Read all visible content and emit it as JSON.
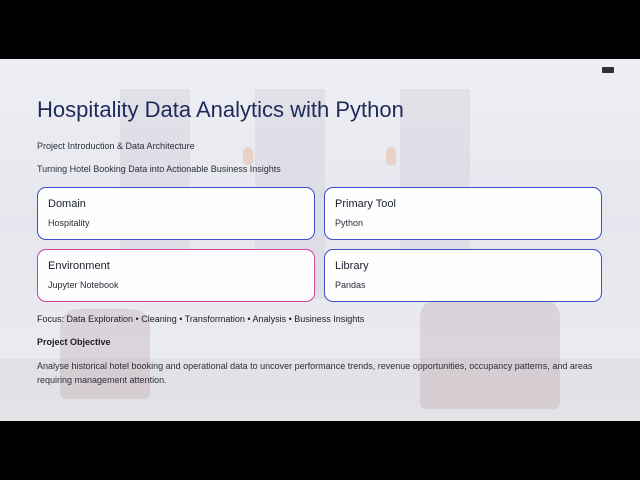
{
  "slide": {
    "title": "Hospitality Data Analytics with Python",
    "subtitle": "Project Introduction & Data Architecture",
    "tagline": "Turning Hotel Booking Data into Actionable Business Insights",
    "cards": [
      {
        "title": "Domain",
        "value": "Hospitality"
      },
      {
        "title": "Primary Tool",
        "value": "Python"
      },
      {
        "title": "Environment",
        "value": "Jupyter Notebook"
      },
      {
        "title": "Library",
        "value": "Pandas"
      }
    ],
    "focus": "Focus: Data Exploration • Cleaning • Transformation • Analysis • Business Insights",
    "objective_heading": "Project Objective",
    "objective_text": "Analyse historical hotel booking and operational data to uncover performance trends, revenue opportunities, occupancy patterns, and areas requiring management attention."
  },
  "colors": {
    "title": "#1e2a5a",
    "card_border_blue": "#3b4fc9",
    "card_border_pink": "#d0449c",
    "letterbox": "#000000"
  }
}
